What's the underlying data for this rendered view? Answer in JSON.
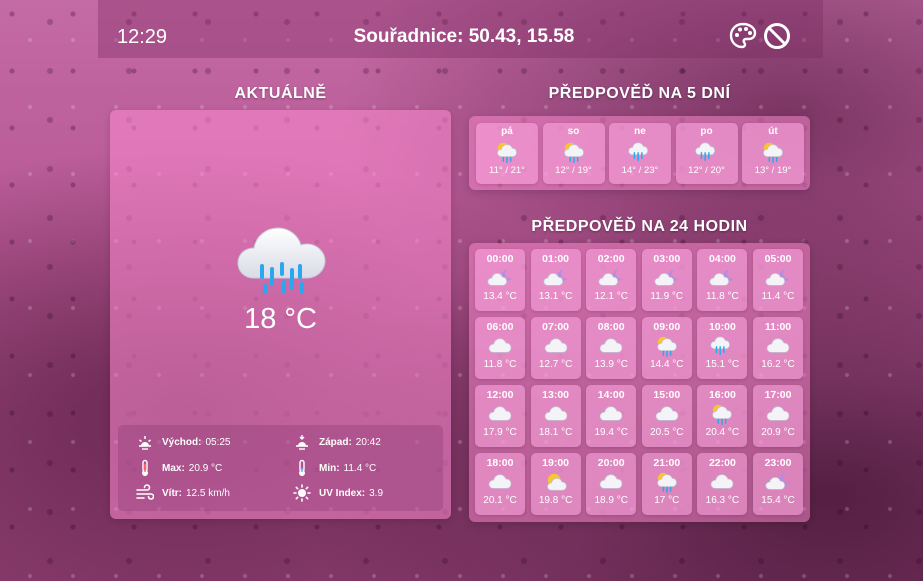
{
  "header": {
    "time": "12:29",
    "coords_label": "Souřadnice: 50.43, 15.58",
    "icons": [
      "palette-icon",
      "disable-icon"
    ]
  },
  "current": {
    "title": "AKTUÁLNĚ",
    "icon": "rain-cloud-icon",
    "temperature": "18 °C",
    "sunrise_label": "Východ:",
    "sunrise": "05:25",
    "sunset_label": "Západ:",
    "sunset": "20:42",
    "max_label": "Max:",
    "max": "20.9 °C",
    "min_label": "Min:",
    "min": "11.4 °C",
    "wind_label": "Vítr:",
    "wind": "12.5 km/h",
    "uv_label": "UV Index:",
    "uv": "3.9"
  },
  "forecast5": {
    "title": "PŘEDPOVĚĎ NA 5 DNÍ",
    "days": [
      {
        "name": "pá",
        "range": "11° / 21°",
        "icon": "sun-rain-icon"
      },
      {
        "name": "so",
        "range": "12° / 19°",
        "icon": "sun-rain-icon"
      },
      {
        "name": "ne",
        "range": "14° / 23°",
        "icon": "rain-cloud-icon"
      },
      {
        "name": "po",
        "range": "12° / 20°",
        "icon": "rain-cloud-icon"
      },
      {
        "name": "út",
        "range": "13° / 19°",
        "icon": "sun-rain-icon"
      }
    ]
  },
  "forecast24": {
    "title": "PŘEDPOVĚĎ NA 24 HODIN",
    "hours": [
      {
        "time": "00:00",
        "temp": "13.4 °C",
        "icon": "moon-cloud-icon"
      },
      {
        "time": "01:00",
        "temp": "13.1 °C",
        "icon": "moon-cloud-icon"
      },
      {
        "time": "02:00",
        "temp": "12.1 °C",
        "icon": "moon-cloud-icon"
      },
      {
        "time": "03:00",
        "temp": "11.9 °C",
        "icon": "moon-cloud-icon"
      },
      {
        "time": "04:00",
        "temp": "11.8 °C",
        "icon": "moon-cloud-icon"
      },
      {
        "time": "05:00",
        "temp": "11.4 °C",
        "icon": "moon-cloud-icon"
      },
      {
        "time": "06:00",
        "temp": "11.8 °C",
        "icon": "cloud-icon"
      },
      {
        "time": "07:00",
        "temp": "12.7 °C",
        "icon": "cloud-icon"
      },
      {
        "time": "08:00",
        "temp": "13.9 °C",
        "icon": "cloud-icon"
      },
      {
        "time": "09:00",
        "temp": "14.4 °C",
        "icon": "sun-rain-icon"
      },
      {
        "time": "10:00",
        "temp": "15.1 °C",
        "icon": "rain-cloud-icon"
      },
      {
        "time": "11:00",
        "temp": "16.2 °C",
        "icon": "cloud-icon"
      },
      {
        "time": "12:00",
        "temp": "17.9 °C",
        "icon": "cloud-icon"
      },
      {
        "time": "13:00",
        "temp": "18.1 °C",
        "icon": "cloud-icon"
      },
      {
        "time": "14:00",
        "temp": "19.4 °C",
        "icon": "cloud-icon"
      },
      {
        "time": "15:00",
        "temp": "20.5 °C",
        "icon": "cloud-icon"
      },
      {
        "time": "16:00",
        "temp": "20.4 °C",
        "icon": "sun-rain-icon"
      },
      {
        "time": "17:00",
        "temp": "20.9 °C",
        "icon": "cloud-icon"
      },
      {
        "time": "18:00",
        "temp": "20.1 °C",
        "icon": "cloud-icon"
      },
      {
        "time": "19:00",
        "temp": "19.8 °C",
        "icon": "sun-cloud-icon"
      },
      {
        "time": "20:00",
        "temp": "18.9 °C",
        "icon": "cloud-icon"
      },
      {
        "time": "21:00",
        "temp": "17 °C",
        "icon": "sun-rain-icon"
      },
      {
        "time": "22:00",
        "temp": "16.3 °C",
        "icon": "cloud-icon"
      },
      {
        "time": "23:00",
        "temp": "15.4 °C",
        "icon": "moon-cloud-icon"
      }
    ]
  }
}
